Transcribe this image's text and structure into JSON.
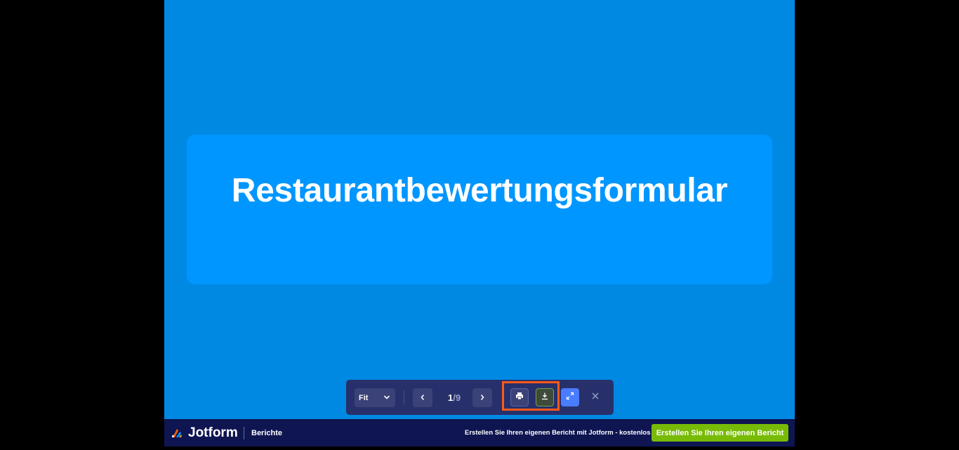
{
  "slide": {
    "title": "Restaurantbewertungsformular"
  },
  "toolbar": {
    "zoom_value": "Fit",
    "page_current": "1",
    "page_separator": "/",
    "page_total": "9"
  },
  "footer": {
    "brand": "Jotform",
    "section": "Berichte",
    "promo_text": "Erstellen Sie Ihren eigenen Bericht mit Jotform - kostenlos",
    "cta_label": "Erstellen Sie Ihren eigenen Bericht"
  },
  "icons": {
    "zoom_dropdown": "chevron-down-icon",
    "prev": "chevron-left-icon",
    "next": "chevron-right-icon",
    "print": "printer-icon",
    "download": "download-icon",
    "fullscreen": "expand-icon",
    "close": "close-icon",
    "logo": "jotform-logo"
  },
  "colors": {
    "slide_bg": "#0089e3",
    "card_bg": "#0096ff",
    "toolbar_bg": "#27306a",
    "footer_bg": "#0e1551",
    "cta_bg": "#78bb07",
    "highlight": "#ff5a1a",
    "fullscreen_btn": "#4a7cff"
  }
}
